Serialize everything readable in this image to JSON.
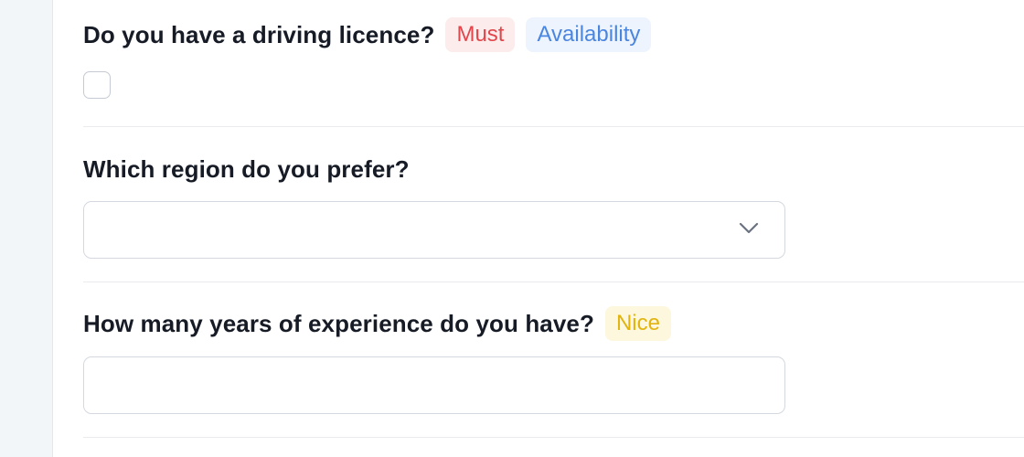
{
  "questions": [
    {
      "title": "Do you have a driving licence?",
      "tags": [
        {
          "label": "Must",
          "color": "#e0474c",
          "bg": "#fdecec"
        },
        {
          "label": "Availability",
          "color": "#4a86e0",
          "bg": "#eef4fd"
        }
      ],
      "input_type": "checkbox",
      "checked": false
    },
    {
      "title": "Which region do you prefer?",
      "tags": [],
      "input_type": "select",
      "selected_value": "",
      "icon": "chevron-down-icon"
    },
    {
      "title": "How many years of experience do you have?",
      "tags": [
        {
          "label": "Nice",
          "color": "#e1b40f",
          "bg": "#fdf7de"
        }
      ],
      "input_type": "text",
      "value": ""
    }
  ]
}
